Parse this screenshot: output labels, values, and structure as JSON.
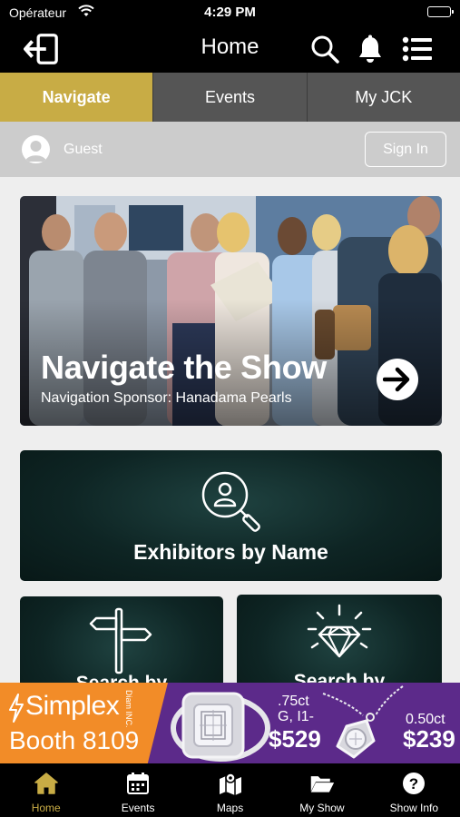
{
  "status_bar": {
    "carrier": "Opérateur",
    "time": "4:29 PM",
    "wifi_icon": "wifi-icon",
    "battery_icon": "battery-icon"
  },
  "nav": {
    "title": "Home",
    "left_icon": "logout-icon",
    "right_icons": [
      "search-icon",
      "bell-icon",
      "list-menu-icon"
    ]
  },
  "tabs": [
    {
      "label": "Navigate",
      "active": true
    },
    {
      "label": "Events",
      "active": false
    },
    {
      "label": "My JCK",
      "active": false
    }
  ],
  "guest": {
    "name": "Guest",
    "sign_in": "Sign In"
  },
  "hero": {
    "title": "Navigate the Show",
    "sponsor": "Navigation Sponsor: Hanadama Pearls",
    "arrow_icon": "arrow-right-icon"
  },
  "cards": {
    "exhibitors": {
      "label": "Exhibitors by Name",
      "icon": "search-person-icon"
    },
    "small": [
      {
        "label": "Search by",
        "icon": "signpost-icon"
      },
      {
        "label": "Search by",
        "icon": "diamond-icon"
      }
    ]
  },
  "ad": {
    "brand": "Simplex",
    "brand_sub": "Diam INC.",
    "booth": "Booth 8109",
    "item1_spec_line1": ".75ct",
    "item1_spec_line2": "G, I1-",
    "item1_price": "$529",
    "item2_spec": "0.50ct",
    "item2_price": "$239"
  },
  "tab_bar": [
    {
      "label": "Home",
      "icon": "home-icon",
      "active": true
    },
    {
      "label": "Events",
      "icon": "calendar-icon",
      "active": false
    },
    {
      "label": "Maps",
      "icon": "map-icon",
      "active": false
    },
    {
      "label": "My Show",
      "icon": "folder-icon",
      "active": false
    },
    {
      "label": "Show Info",
      "icon": "question-icon",
      "active": false
    }
  ],
  "colors": {
    "accent": "#c8ac45",
    "tab_inactive": "#555555",
    "card_dark": "#0e2524",
    "ad_orange": "#f28c28",
    "ad_purple": "#5c2a8a"
  }
}
